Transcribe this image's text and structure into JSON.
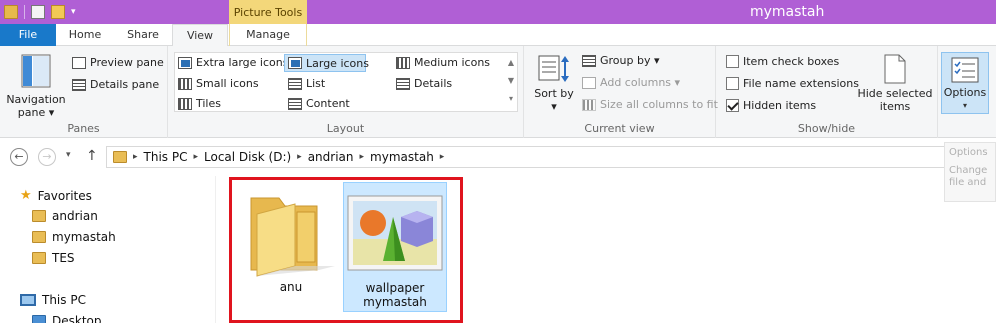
{
  "titlebar": {
    "window_title": "mymastah",
    "context_group": "Picture Tools",
    "accent_color": "#b05fd5"
  },
  "tabs": {
    "file": "File",
    "home": "Home",
    "share": "Share",
    "view": "View",
    "manage": "Manage"
  },
  "ribbon": {
    "panes": {
      "navigation_pane": "Navigation pane ▾",
      "preview_pane": "Preview pane",
      "details_pane": "Details pane",
      "label": "Panes"
    },
    "layout": {
      "extra_large_icons": "Extra large icons",
      "large_icons": "Large icons",
      "medium_icons": "Medium icons",
      "small_icons": "Small icons",
      "list": "List",
      "details": "Details",
      "tiles": "Tiles",
      "content": "Content",
      "label": "Layout"
    },
    "current_view": {
      "sort_by": "Sort by ▾",
      "group_by": "Group by ▾",
      "add_columns": "Add columns ▾",
      "size_all_columns": "Size all columns to fit",
      "label": "Current view"
    },
    "show_hide": {
      "item_check_boxes": "Item check boxes",
      "file_name_extensions": "File name extensions",
      "hidden_items": "Hidden items",
      "hide_selected_items": "Hide selected items",
      "label": "Show/hide"
    },
    "options": {
      "label": "Options"
    }
  },
  "address_bar": {
    "crumbs": [
      "This PC",
      "Local Disk (D:)",
      "andrian",
      "mymastah"
    ]
  },
  "navpane": {
    "favorites": "Favorites",
    "items": [
      "andrian",
      "mymastah",
      "TES"
    ],
    "this_pc": "This PC",
    "desktop": "Desktop"
  },
  "files": [
    {
      "name": "anu",
      "icon": "folder-icon"
    },
    {
      "name": "wallpaper mymastah",
      "icon": "image-icon"
    }
  ],
  "options_hint": {
    "line1": "Options",
    "line2": "Change",
    "line3": "file and"
  }
}
